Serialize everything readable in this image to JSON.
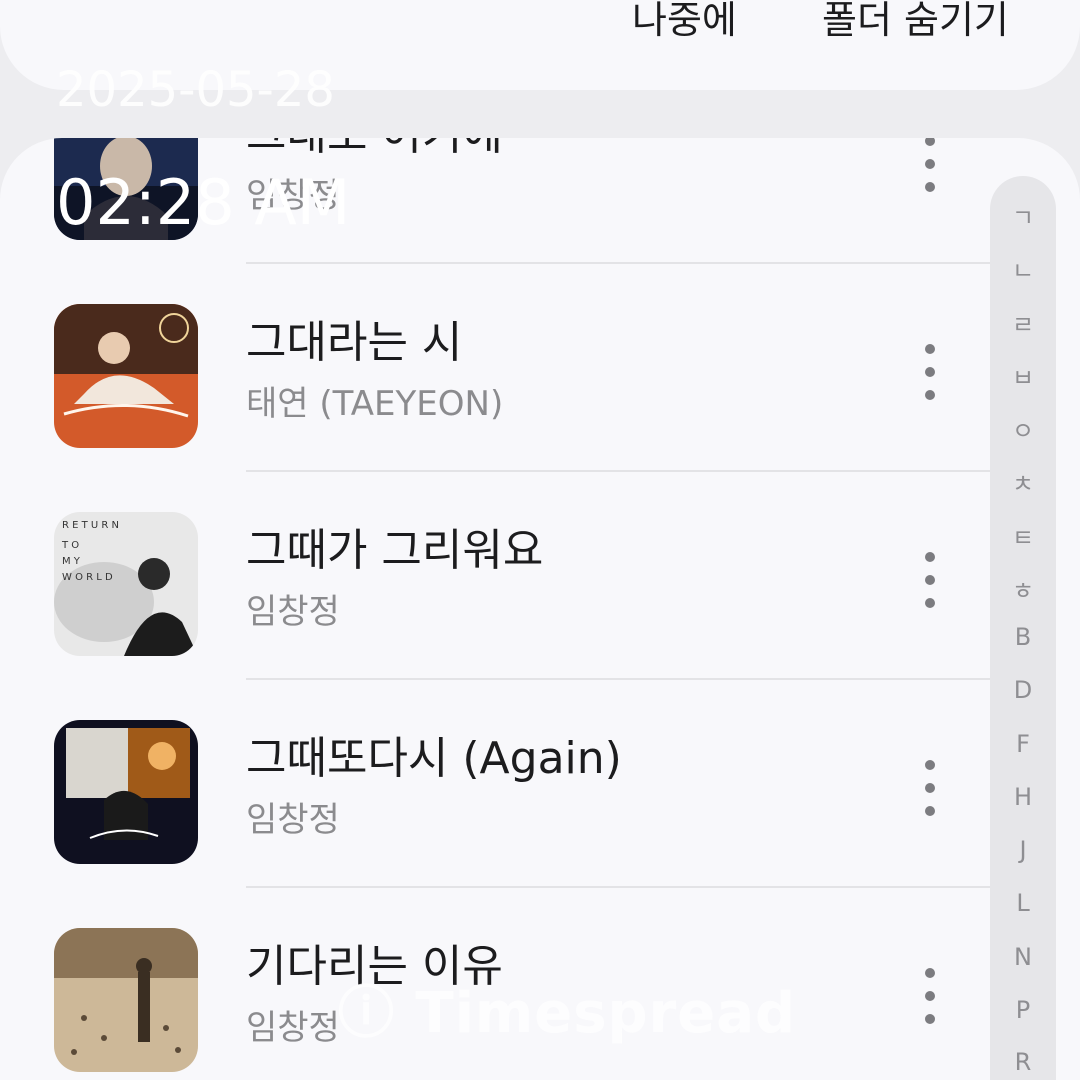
{
  "top_actions": {
    "later_label": "나중에",
    "hide_folder_label": "폴더 숨기기"
  },
  "overlay": {
    "date": "2025-05-28",
    "time": "02:28 AM",
    "watermark": "ⓘ Timespread"
  },
  "songs": [
    {
      "title": "그대로 여기에",
      "artist": "임창정",
      "art": "album-art-1"
    },
    {
      "title": "그대라는 시",
      "artist": "태연 (TAEYEON)",
      "art": "album-art-2"
    },
    {
      "title": "그때가 그리워요",
      "artist": "임창정",
      "art": "album-art-3"
    },
    {
      "title": "그때또다시 (Again)",
      "artist": "임창정",
      "art": "album-art-4"
    },
    {
      "title": "기다리는 이유",
      "artist": "임창정",
      "art": "album-art-5"
    }
  ],
  "index_letters": [
    "ㄱ",
    "ㄴ",
    "ㄹ",
    "ㅂ",
    "ㅇ",
    "ㅊ",
    "ㅌ",
    "ㅎ",
    "B",
    "D",
    "F",
    "H",
    "J",
    "L",
    "N",
    "P",
    "R"
  ],
  "album3_text": [
    "R E T U R N",
    "T O",
    "M Y",
    "W O R L D"
  ],
  "colors": {
    "background": "#ededf0",
    "card": "#f8f8fb",
    "text": "#1c1c1e",
    "secondary": "#8b8b8e",
    "index_bar": "#e6e6e9"
  }
}
